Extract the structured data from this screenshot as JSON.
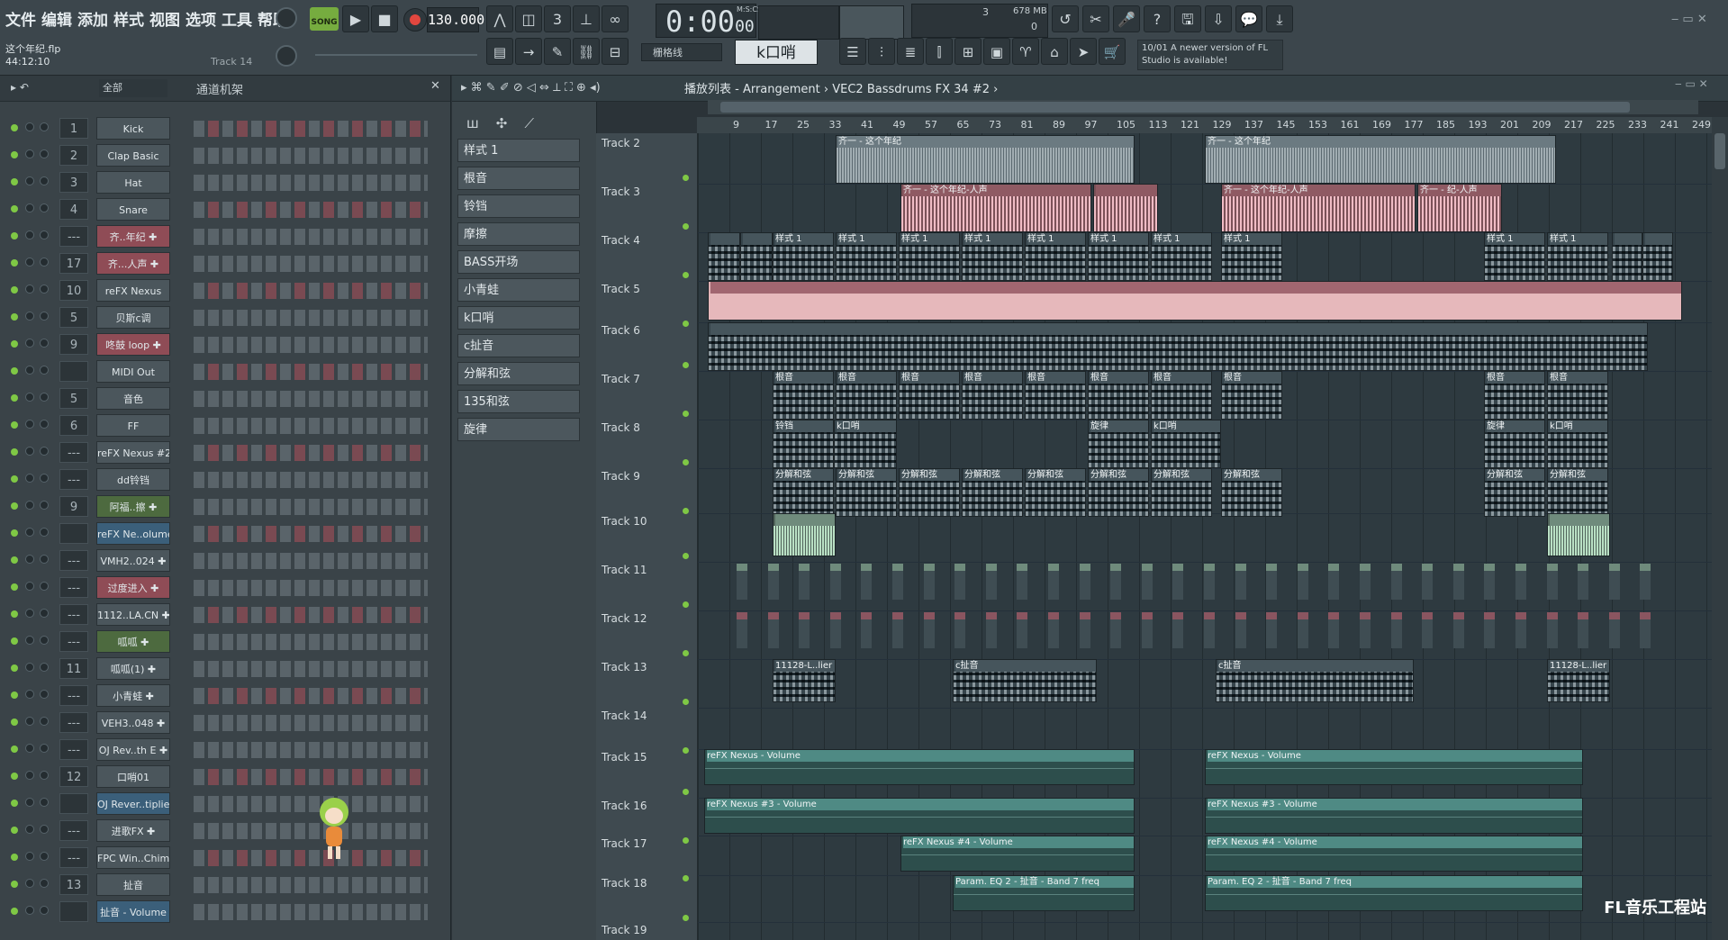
{
  "menu": [
    "文件",
    "编辑",
    "添加",
    "样式",
    "视图",
    "选项",
    "工具",
    "帮助"
  ],
  "project": {
    "file": "这个年纪.flp",
    "time": "44:12:10",
    "hint": "Track 14"
  },
  "transport": {
    "song_label": "SONG",
    "tempo": "130.000",
    "time": "0:00",
    "time_frac": "00",
    "time_unit": "M:S:CS",
    "cpu": "3",
    "mem": "678 MB",
    "poly": "0"
  },
  "snap": {
    "label": "栅格线",
    "pattern": "k口哨"
  },
  "news": {
    "date": "10/01",
    "text": "A newer version of FL Studio is available!"
  },
  "rack": {
    "filter": "全部",
    "title": "通道机架"
  },
  "channels": [
    {
      "num": "1",
      "name": "Kick",
      "style": ""
    },
    {
      "num": "2",
      "name": "Clap Basic",
      "style": ""
    },
    {
      "num": "3",
      "name": "Hat",
      "style": ""
    },
    {
      "num": "4",
      "name": "Snare",
      "style": ""
    },
    {
      "num": "---",
      "name": "齐..年纪 ✚",
      "style": "pink"
    },
    {
      "num": "17",
      "name": "齐...人声 ✚",
      "style": "pink"
    },
    {
      "num": "10",
      "name": "reFX Nexus",
      "style": ""
    },
    {
      "num": "5",
      "name": "贝斯c调",
      "style": ""
    },
    {
      "num": "9",
      "name": "咚鼓 loop ✚",
      "style": "pink"
    },
    {
      "num": "",
      "name": "MIDI Out",
      "style": ""
    },
    {
      "num": "5",
      "name": "音色",
      "style": ""
    },
    {
      "num": "6",
      "name": "FF",
      "style": ""
    },
    {
      "num": "---",
      "name": "reFX Nexus #2",
      "style": ""
    },
    {
      "num": "---",
      "name": "dd铃铛",
      "style": ""
    },
    {
      "num": "9",
      "name": "阿福..擦 ✚",
      "style": "green"
    },
    {
      "num": "",
      "name": "reFX Ne..olume",
      "style": "blue"
    },
    {
      "num": "---",
      "name": "VMH2..024 ✚",
      "style": ""
    },
    {
      "num": "---",
      "name": "过度进入 ✚",
      "style": "pink"
    },
    {
      "num": "---",
      "name": "1112..LA.CN ✚",
      "style": ""
    },
    {
      "num": "---",
      "name": "呱呱 ✚",
      "style": "green"
    },
    {
      "num": "11",
      "name": "呱呱(1) ✚",
      "style": ""
    },
    {
      "num": "---",
      "name": "小青蛙 ✚",
      "style": ""
    },
    {
      "num": "---",
      "name": "VEH3..048 ✚",
      "style": ""
    },
    {
      "num": "---",
      "name": "OJ Rev..th E ✚",
      "style": ""
    },
    {
      "num": "12",
      "name": "口哨01",
      "style": ""
    },
    {
      "num": "",
      "name": "OJ Rever..tiplier",
      "style": "blue"
    },
    {
      "num": "---",
      "name": "进歌FX ✚",
      "style": ""
    },
    {
      "num": "---",
      "name": "FPC Win..Chimes",
      "style": ""
    },
    {
      "num": "13",
      "name": "扯音",
      "style": ""
    },
    {
      "num": "",
      "name": "扯音 - Volume",
      "style": "blue"
    }
  ],
  "patterns": [
    "样式 1",
    "根音",
    "铃铛",
    "摩擦",
    "BASS开场",
    "小青蛙",
    "k口哨",
    "c扯音",
    "分解和弦",
    "135和弦",
    "旋律"
  ],
  "playlist": {
    "title": "播放列表 - Arrangement › VEC2 Bassdrums FX 34 #2 ›"
  },
  "ruler": [
    "9",
    "17",
    "25",
    "33",
    "41",
    "49",
    "57",
    "65",
    "73",
    "81",
    "89",
    "97",
    "105",
    "113",
    "121",
    "129",
    "137",
    "145",
    "153",
    "161",
    "169",
    "177",
    "185",
    "193",
    "201",
    "209",
    "217",
    "225",
    "233",
    "241",
    "249"
  ],
  "tracks": [
    "Track 2",
    "Track 3",
    "Track 4",
    "Track 5",
    "Track 6",
    "Track 7",
    "Track 8",
    "Track 9",
    "Track 10",
    "Track 11",
    "Track 12",
    "Track 13",
    "Track 14",
    "Track 15",
    "Track 16",
    "Track 17",
    "Track 18",
    "Track 19"
  ],
  "clips": {
    "vocal1": "齐一 - 这个年纪",
    "vocal2": "齐一 - 这个年纪-人声",
    "vocal3": "齐一 - 纪-人声",
    "pattern1": "样式 1",
    "root": "根音",
    "bell": "铃铛",
    "whistle": "k口哨",
    "melody": "旋律",
    "arp": "分解和弦",
    "lier": "11128-L..lier",
    "cpull": "c扯音",
    "nexus": "reFX Nexus - Volume",
    "nexus3": "reFX Nexus #3 - Volume",
    "nexus4": "reFX Nexus #4 - Volume",
    "eq": "Param. EQ 2 - 扯音 - Band 7 freq"
  },
  "watermark": "FL音乐工程站"
}
